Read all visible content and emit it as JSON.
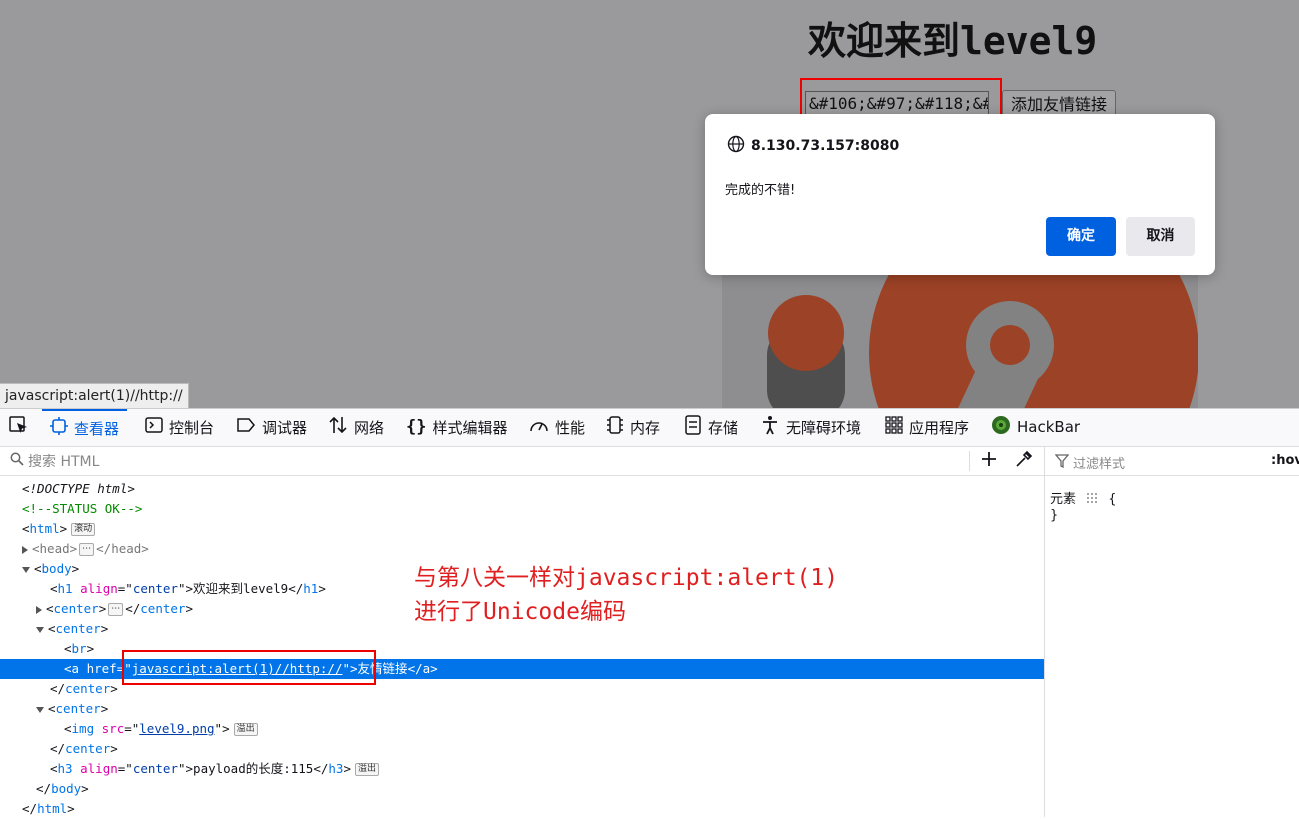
{
  "page": {
    "heading": "欢迎来到level9",
    "input_value": "&#106;&#97;&#118;&#",
    "submit_label": "添加友情链接",
    "status_url": "javascript:alert(1)//http://"
  },
  "dialog": {
    "origin": "8.130.73.157:8080",
    "message": "完成的不错!",
    "ok_label": "确定",
    "cancel_label": "取消"
  },
  "devtools": {
    "tabs": [
      "查看器",
      "控制台",
      "调试器",
      "网络",
      "样式编辑器",
      "性能",
      "内存",
      "存储",
      "无障碍环境",
      "应用程序",
      "HackBar"
    ],
    "search_placeholder": "搜索 HTML",
    "filter_placeholder": "过滤样式",
    "hov_label": ":hov",
    "rule_selector": "元素",
    "brace_open": "{",
    "brace_close": "}",
    "badges": {
      "scroll": "滚动",
      "overflow": "溢出",
      "ellipsis": "⋯"
    },
    "code": {
      "doctype": "<!DOCTYPE html>",
      "comment": "<!--STATUS OK-->",
      "h1_text": "欢迎来到level9",
      "href_value": "javascript:alert(1)//http://",
      "link_text": "友情链接",
      "img_src": "level9.png",
      "h3_text": "payload的长度:115"
    }
  },
  "annotation": {
    "line1_prefix": "与第八关一样对",
    "line1_code": "javascript:alert(1)",
    "line2_prefix": "进行了",
    "line2_code": "Unicode",
    "line2_suffix": "编码"
  },
  "colors": {
    "accent": "#0061e0",
    "annotation": "#e02020",
    "selection": "#0074e8"
  }
}
